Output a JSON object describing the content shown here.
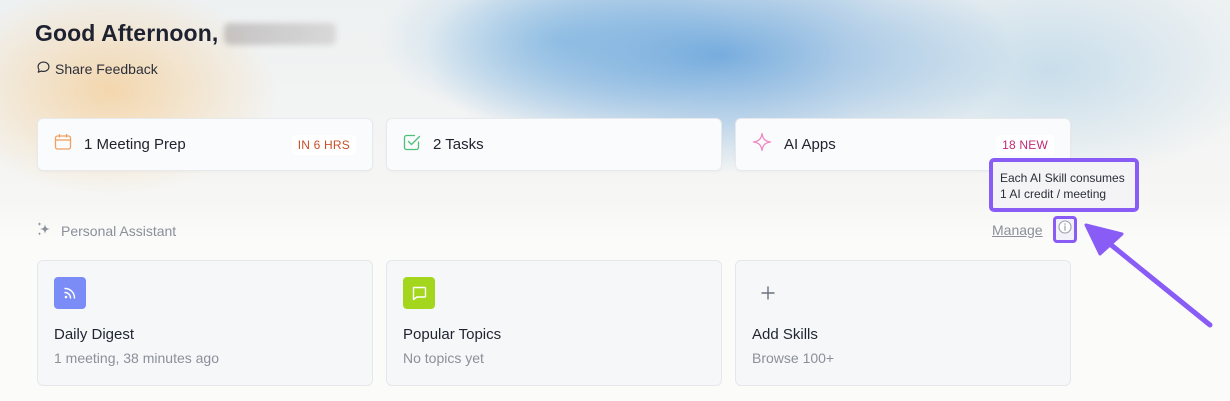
{
  "header": {
    "greeting": "Good Afternoon,",
    "feedback_label": "Share Feedback"
  },
  "summary_cards": [
    {
      "label": "1 Meeting Prep",
      "badge": "IN 6 HRS",
      "icon": "calendar-icon"
    },
    {
      "label": "2 Tasks",
      "icon": "checkbox-icon"
    },
    {
      "label": "AI Apps",
      "badge": "18 NEW",
      "icon": "sparkle-icon"
    }
  ],
  "assistant": {
    "section_title": "Personal Assistant",
    "manage_label": "Manage",
    "tooltip_line1": "Each AI Skill consumes",
    "tooltip_line2": "1 AI credit / meeting"
  },
  "skills": [
    {
      "title": "Daily Digest",
      "subtitle": "1 meeting, 38 minutes ago",
      "icon": "rss-icon"
    },
    {
      "title": "Popular Topics",
      "subtitle": "No topics yet",
      "icon": "chat-icon"
    },
    {
      "title": "Add Skills",
      "subtitle": "Browse 100+",
      "icon": "plus-icon"
    }
  ],
  "colors": {
    "highlight": "#8a5cf6",
    "rss_bg": "#7b8cf7",
    "chat_bg": "#a3d61c",
    "badge_orange": "#c7502a",
    "badge_pink": "#c02a77"
  }
}
